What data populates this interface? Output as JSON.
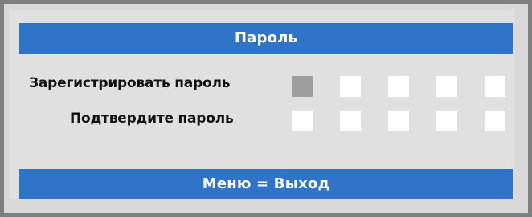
{
  "title": "Пароль",
  "rows": [
    {
      "label": "Зарегистрировать пароль",
      "slots": 5,
      "active_slot": 1
    },
    {
      "label": "Подтвердите пароль",
      "slots": 5,
      "active_slot": 0
    }
  ],
  "footer": "Меню = Выход",
  "colors": {
    "accent": "#2f74c8",
    "panel": "#e0e0e0",
    "slot_empty": "#ffffff",
    "slot_active": "#9e9e9e"
  }
}
